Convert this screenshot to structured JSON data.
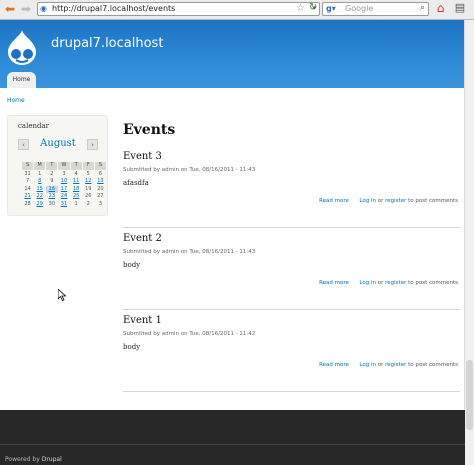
{
  "browser": {
    "url": "http://drupal7.localhost/events",
    "search_placeholder": "Google"
  },
  "site": {
    "name": "drupal7.localhost",
    "tab_home": "Home"
  },
  "breadcrumb": "Home",
  "calendar": {
    "title": "calendar",
    "month": "August",
    "prev": "‹",
    "next": "›",
    "weekdays": [
      "S",
      "M",
      "T",
      "W",
      "T",
      "F",
      "S"
    ],
    "weeks": [
      [
        "31",
        "1",
        "2",
        "3",
        "4",
        "5",
        "6"
      ],
      [
        "7",
        "8",
        "9",
        "10",
        "11",
        "12",
        "13"
      ],
      [
        "14",
        "15",
        "16",
        "17",
        "18",
        "19",
        "20"
      ],
      [
        "21",
        "22",
        "23",
        "24",
        "25",
        "26",
        "27"
      ],
      [
        "28",
        "29",
        "30",
        "31",
        "1",
        "2",
        "3"
      ]
    ]
  },
  "page_title": "Events",
  "events": [
    {
      "title": "Event 3",
      "submitted": "Submitted by admin on Tue, 08/16/2011 - 11:43",
      "body": "afasdfa",
      "read_more": "Read more",
      "login": "Log in",
      "or": "or",
      "register": "register",
      "post_comments": "to post comments"
    },
    {
      "title": "Event 2",
      "submitted": "Submitted by admin on Tue, 08/16/2011 - 11:43",
      "body": "body",
      "read_more": "Read more",
      "login": "Log in",
      "or": "or",
      "register": "register",
      "post_comments": "to post comments"
    },
    {
      "title": "Event 1",
      "submitted": "Submitted by admin on Tue, 08/16/2011 - 11:42",
      "body": "body",
      "read_more": "Read more",
      "login": "Log in",
      "or": "or",
      "register": "register",
      "post_comments": "to post comments"
    }
  ],
  "footer": {
    "powered_by": "Powered by",
    "drupal": "Drupal"
  }
}
